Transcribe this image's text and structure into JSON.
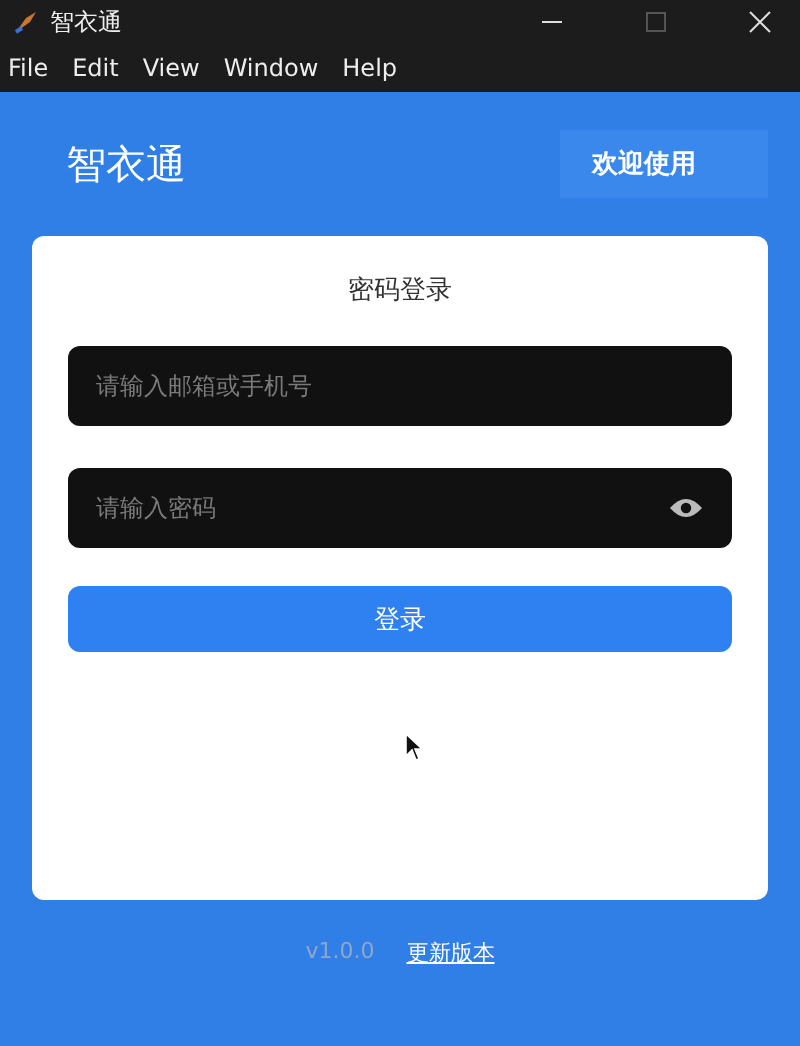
{
  "window": {
    "title": "智衣通"
  },
  "menu": [
    "File",
    "Edit",
    "View",
    "Window",
    "Help"
  ],
  "header": {
    "logo": "智衣通",
    "welcome": "欢迎使用"
  },
  "login": {
    "title": "密码登录",
    "account": {
      "placeholder": "请输入邮箱或手机号"
    },
    "password": {
      "placeholder": "请输入密码"
    },
    "submit": "登录"
  },
  "footer": {
    "version": "v1.0.0",
    "update_link": "更新版本"
  }
}
